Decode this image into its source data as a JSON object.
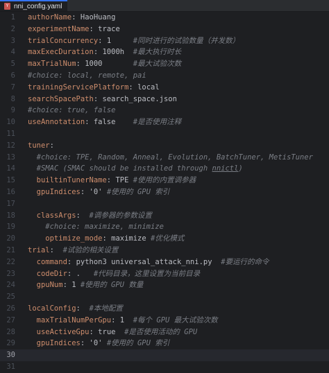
{
  "tab": {
    "label": "nni_config.yaml",
    "icon": "yaml-file-icon"
  },
  "lines": [
    {
      "n": "1",
      "key": "authorName",
      "sep": ": ",
      "val": "HaoHuang",
      "comment": ""
    },
    {
      "n": "2",
      "key": "experimentName",
      "sep": ": ",
      "val": "trace",
      "comment": ""
    },
    {
      "n": "3",
      "key": "trialConcurrency",
      "sep": ": ",
      "val": "1     ",
      "comment": "#同时进行的试验数量（并发数）"
    },
    {
      "n": "4",
      "key": "maxExecDuration",
      "sep": ": ",
      "val": "1000h  ",
      "comment": "#最大执行时长"
    },
    {
      "n": "5",
      "key": "maxTrialNum",
      "sep": ": ",
      "val": "1000       ",
      "comment": "#最大试验次数"
    },
    {
      "n": "6",
      "key": "",
      "sep": "",
      "val": "",
      "comment": "#choice: local, remote, pai"
    },
    {
      "n": "7",
      "key": "trainingServicePlatform",
      "sep": ": ",
      "val": "local",
      "comment": ""
    },
    {
      "n": "8",
      "key": "searchSpacePath",
      "sep": ": ",
      "val": "search_space.json",
      "comment": ""
    },
    {
      "n": "9",
      "key": "",
      "sep": "",
      "val": "",
      "comment": "#choice: true, false"
    },
    {
      "n": "10",
      "key": "useAnnotation",
      "sep": ": ",
      "val": "false    ",
      "comment": "#是否使用注释"
    },
    {
      "n": "11",
      "key": "",
      "sep": "",
      "val": "",
      "comment": ""
    },
    {
      "n": "12",
      "key": "tuner",
      "sep": ":",
      "val": "",
      "comment": ""
    },
    {
      "n": "13",
      "key": "",
      "sep": "",
      "val": "",
      "comment": "  #choice: TPE, Random, Anneal, Evolution, BatchTuner, MetisTuner"
    },
    {
      "n": "14",
      "key": "",
      "sep": "",
      "val": "",
      "comment": "  #SMAC (SMAC should be installed through "
    },
    {
      "n": "15",
      "key": "  builtinTunerName",
      "sep": ": ",
      "val": "TPE ",
      "comment": "#使用的内置调参器"
    },
    {
      "n": "16",
      "key": "  gpuIndices",
      "sep": ": ",
      "val": "'0' ",
      "comment": "#使用的 GPU 索引"
    },
    {
      "n": "17",
      "key": "",
      "sep": "",
      "val": "",
      "comment": ""
    },
    {
      "n": "18",
      "key": "  classArgs",
      "sep": ":  ",
      "val": "",
      "comment": "#调参器的参数设置"
    },
    {
      "n": "19",
      "key": "",
      "sep": "",
      "val": "",
      "comment": "    #choice: maximize, minimize"
    },
    {
      "n": "20",
      "key": "    optimize_mode",
      "sep": ": ",
      "val": "maximize ",
      "comment": "#优化模式"
    },
    {
      "n": "21",
      "key": "trial",
      "sep": ":  ",
      "val": "",
      "comment": "#试验的相关设置"
    },
    {
      "n": "22",
      "key": "  command",
      "sep": ": ",
      "val": "python3 universal_attack_nni.py  ",
      "comment": "#要运行的命令"
    },
    {
      "n": "23",
      "key": "  codeDir",
      "sep": ": ",
      "val": ".   ",
      "comment": "#代码目录，这里设置为当前目录"
    },
    {
      "n": "24",
      "key": "  gpuNum",
      "sep": ": ",
      "val": "1 ",
      "comment": "#使用的 GPU 数量"
    },
    {
      "n": "25",
      "key": "",
      "sep": "",
      "val": "",
      "comment": ""
    },
    {
      "n": "26",
      "key": "localConfig",
      "sep": ":  ",
      "val": "",
      "comment": "#本地配置"
    },
    {
      "n": "27",
      "key": "  maxTrialNumPerGpu",
      "sep": ": ",
      "val": "1  ",
      "comment": "#每个 GPU 最大试验次数"
    },
    {
      "n": "28",
      "key": "  useActiveGpu",
      "sep": ": ",
      "val": "true  ",
      "comment": "#是否使用活动的 GPU"
    },
    {
      "n": "29",
      "key": "  gpuIndices",
      "sep": ": ",
      "val": "'0' ",
      "comment": "#使用的 GPU 索引"
    },
    {
      "n": "30",
      "key": "",
      "sep": "",
      "val": "",
      "comment": ""
    },
    {
      "n": "31",
      "key": "",
      "sep": "",
      "val": "",
      "comment": ""
    }
  ],
  "line14_link": "nnictl",
  "line14_tail": ")",
  "current_line": "30",
  "colors": {
    "key": "#cf8e6d",
    "comment": "#7a7e85",
    "text": "#bcbec4",
    "background": "#1e1f22"
  }
}
